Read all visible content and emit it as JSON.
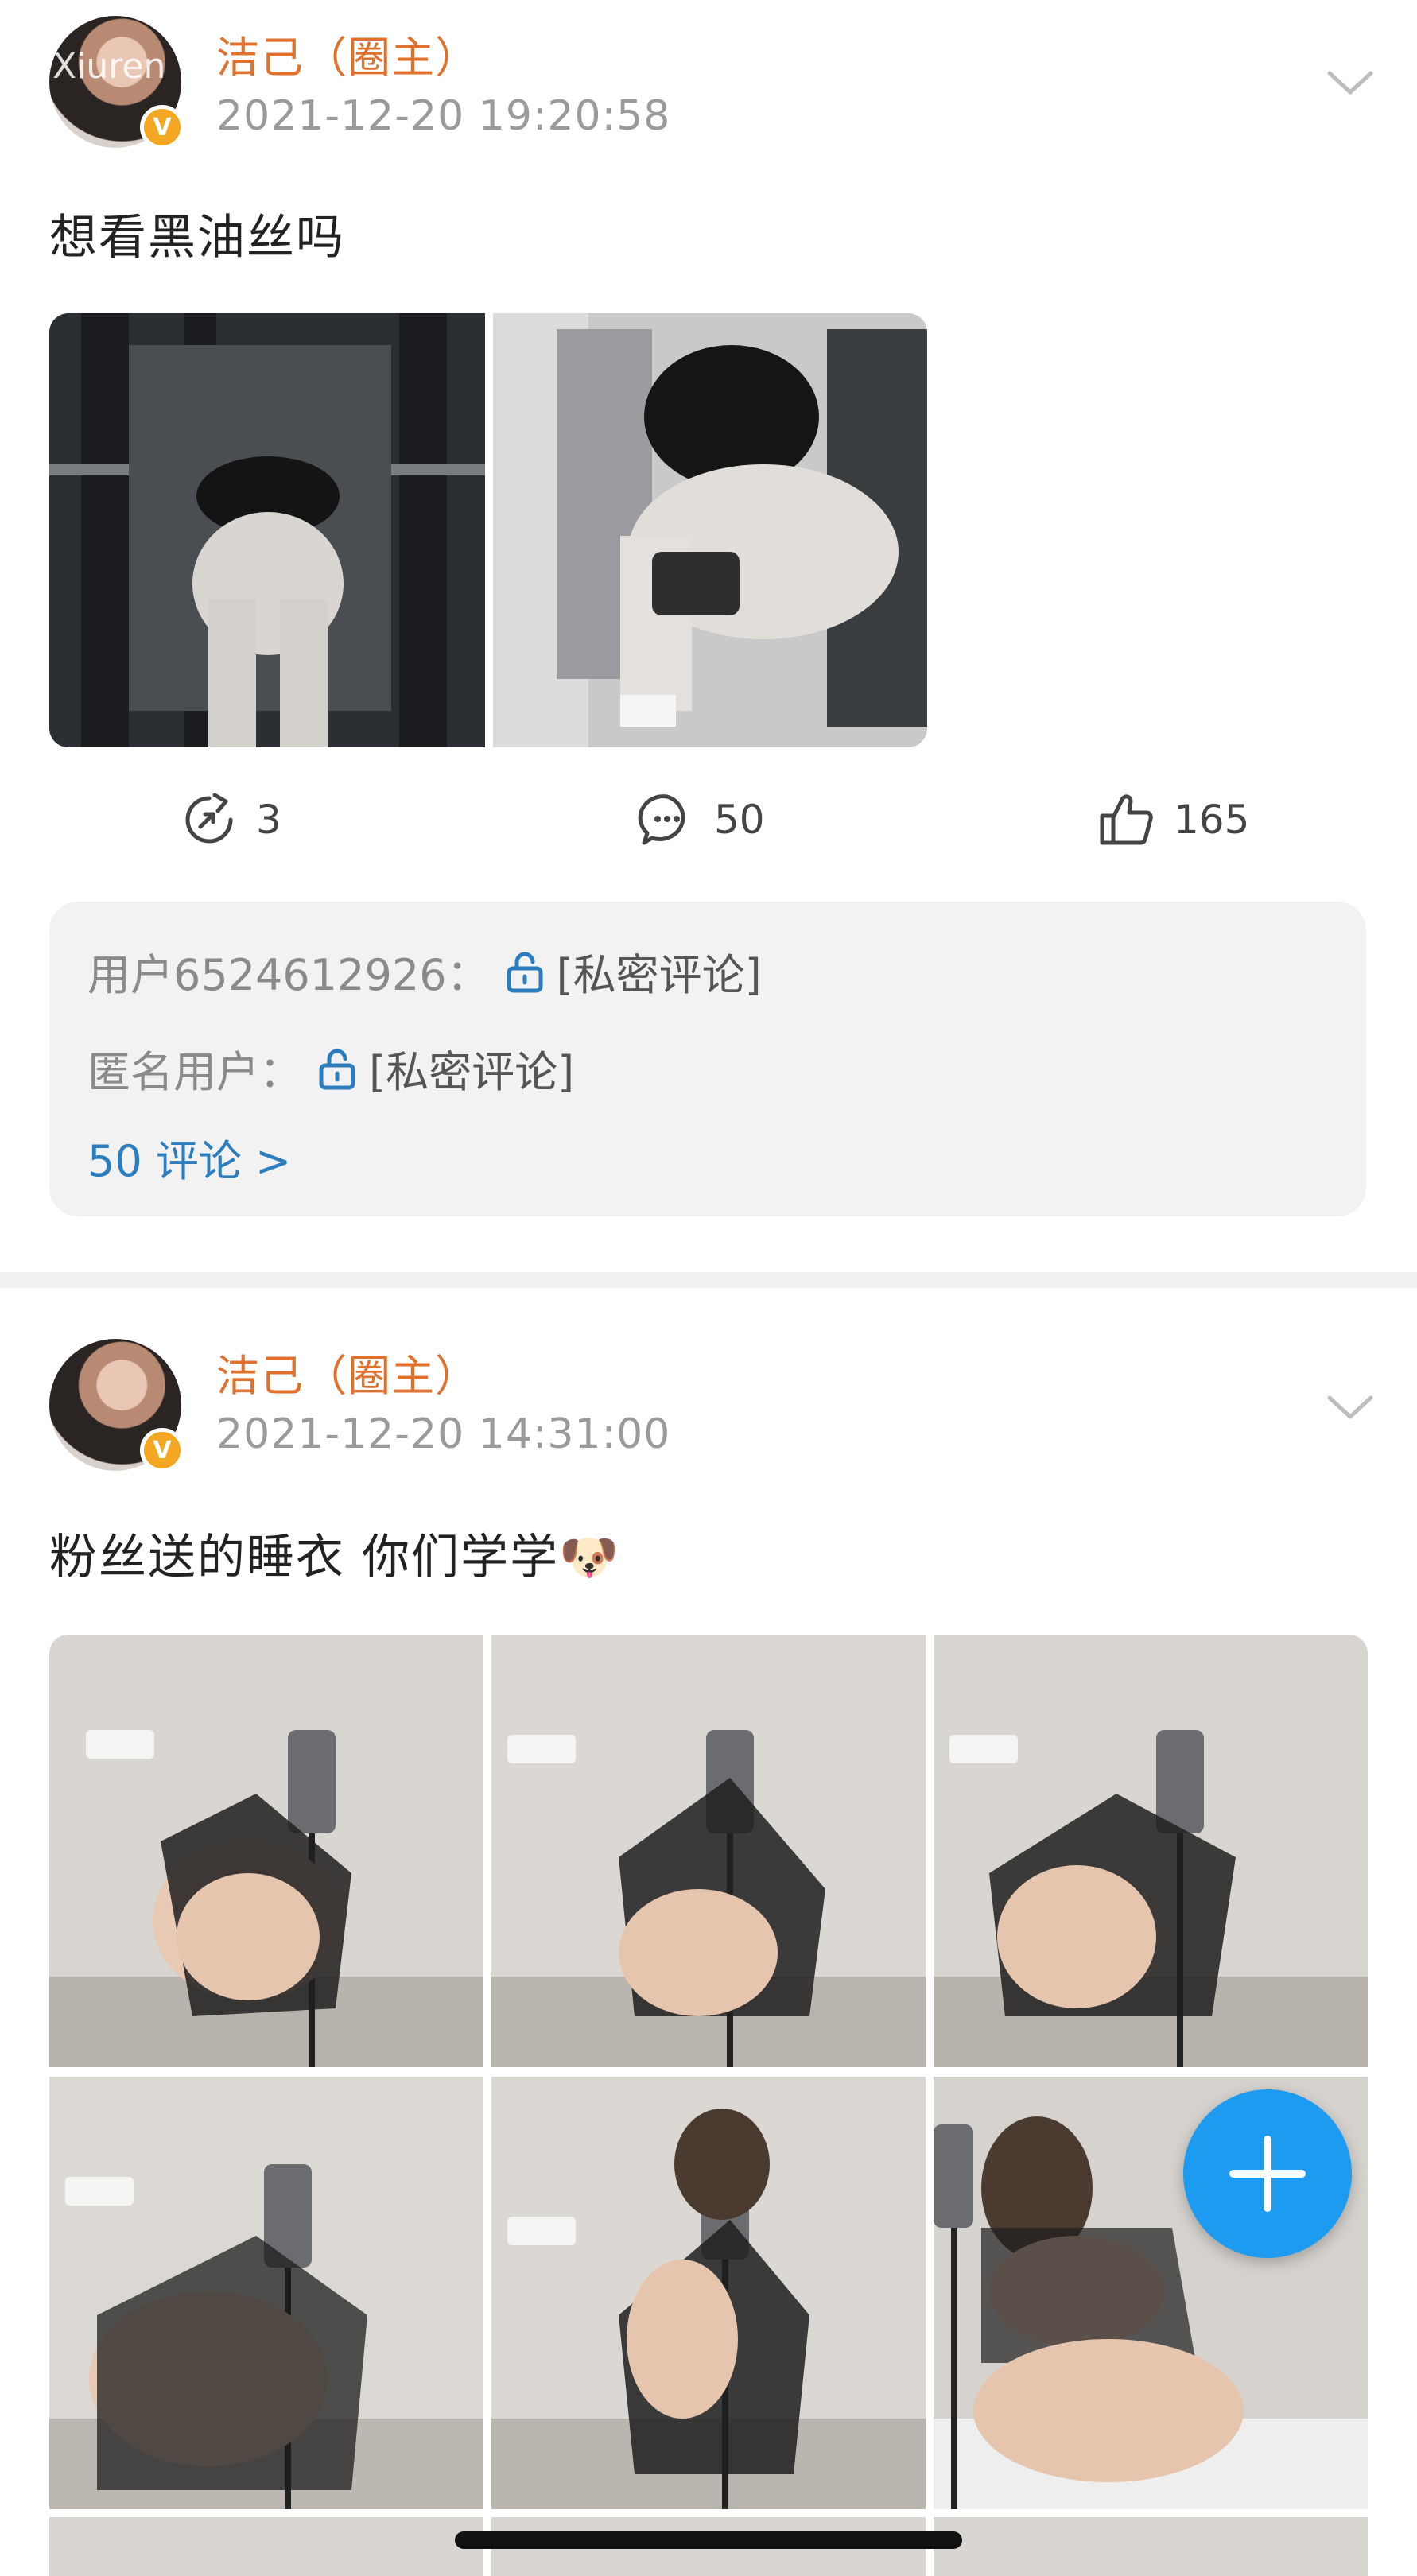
{
  "posts": [
    {
      "username": "洁己（圈主）",
      "timestamp": "2021-12-20 19:20:58",
      "text": "想看黑油丝吗",
      "photos": [
        {
          "alt": "gym-photo-1"
        },
        {
          "alt": "gym-photo-2"
        }
      ],
      "actions": {
        "repost_count": "3",
        "comment_count": "50",
        "like_count": "165"
      },
      "comments": [
        {
          "user": "用户6524612926：",
          "text": "[私密评论]"
        },
        {
          "user": "匿名用户：",
          "text": "[私密评论]"
        }
      ],
      "more_comments": "50 评论 >"
    },
    {
      "username": "洁己（圈主）",
      "timestamp": "2021-12-20 14:31:00",
      "text": "粉丝送的睡衣 你们学学🐶"
    }
  ],
  "watermark": "Xiuren",
  "icons": {
    "verified": "verified-badge-icon",
    "repost": "repost-icon",
    "comment": "comment-icon",
    "like": "thumbs-up-icon",
    "lock": "lock-icon",
    "expand": "chevron-down-icon",
    "add": "plus-icon"
  },
  "colors": {
    "username": "#e0712c",
    "link": "#2c7dc0",
    "fab": "#1d9bf0",
    "verified": "#f5a623"
  }
}
